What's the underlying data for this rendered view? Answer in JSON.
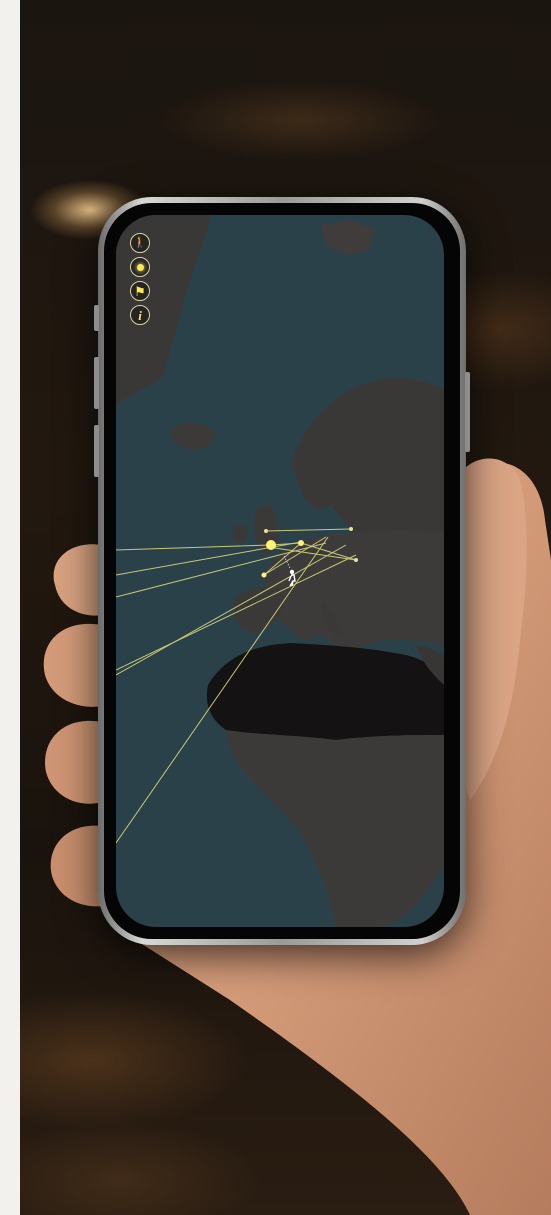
{
  "scene": {
    "description_free": true
  },
  "map_app": {
    "toolbar": {
      "buttons": [
        {
          "icon": "person-walking-icon",
          "glyph": "🚶"
        },
        {
          "icon": "light-dot-icon",
          "glyph": ""
        },
        {
          "icon": "flag-icon",
          "glyph": "⚑"
        },
        {
          "icon": "info-icon",
          "glyph": "i"
        }
      ]
    },
    "colors": {
      "ocean": "#2b4149",
      "land": "#3d3b3a",
      "desert": "#141212",
      "route_lines": "#d6d87c",
      "highlight_points": "#fff27a"
    }
  }
}
